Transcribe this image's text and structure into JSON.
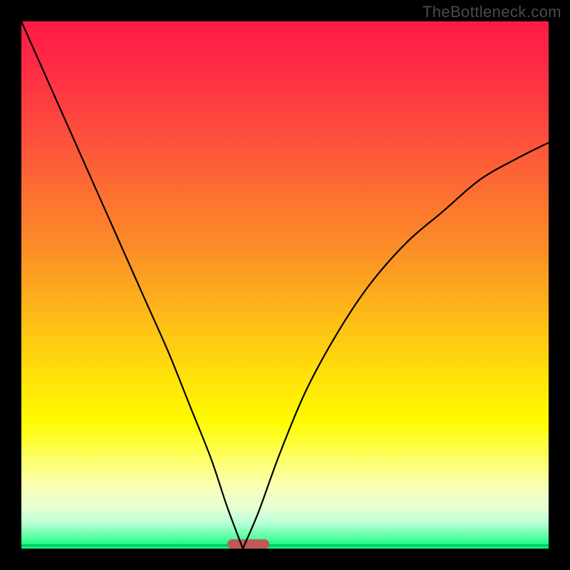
{
  "watermark_text": "TheBottleneck.com",
  "colors": {
    "black": "#000000",
    "curve": "#000000",
    "gradient_top": "#ff1a47",
    "gradient_mid": "#ffe00a",
    "gradient_bottom": "#00f07a",
    "marker": "#c05858"
  },
  "chart_data": {
    "type": "line",
    "title": "",
    "xlabel": "",
    "ylabel": "",
    "xlim": [
      0,
      100
    ],
    "ylim": [
      0,
      100
    ],
    "grid": false,
    "legend": false,
    "minimum_x": 42,
    "marker_range_x": [
      39,
      47
    ],
    "rendered_points_left": [
      {
        "x": 0,
        "y": 100
      },
      {
        "x": 4,
        "y": 91
      },
      {
        "x": 8,
        "y": 82
      },
      {
        "x": 12,
        "y": 73
      },
      {
        "x": 16,
        "y": 64
      },
      {
        "x": 20,
        "y": 55
      },
      {
        "x": 24,
        "y": 46
      },
      {
        "x": 28,
        "y": 37
      },
      {
        "x": 32,
        "y": 27
      },
      {
        "x": 36,
        "y": 17
      },
      {
        "x": 39,
        "y": 8
      },
      {
        "x": 42,
        "y": 0
      }
    ],
    "rendered_points_right": [
      {
        "x": 42,
        "y": 0
      },
      {
        "x": 45,
        "y": 7
      },
      {
        "x": 49,
        "y": 18
      },
      {
        "x": 54,
        "y": 30
      },
      {
        "x": 60,
        "y": 41
      },
      {
        "x": 66,
        "y": 50
      },
      {
        "x": 73,
        "y": 58
      },
      {
        "x": 80,
        "y": 64
      },
      {
        "x": 87,
        "y": 70
      },
      {
        "x": 94,
        "y": 74
      },
      {
        "x": 100,
        "y": 77
      }
    ]
  }
}
